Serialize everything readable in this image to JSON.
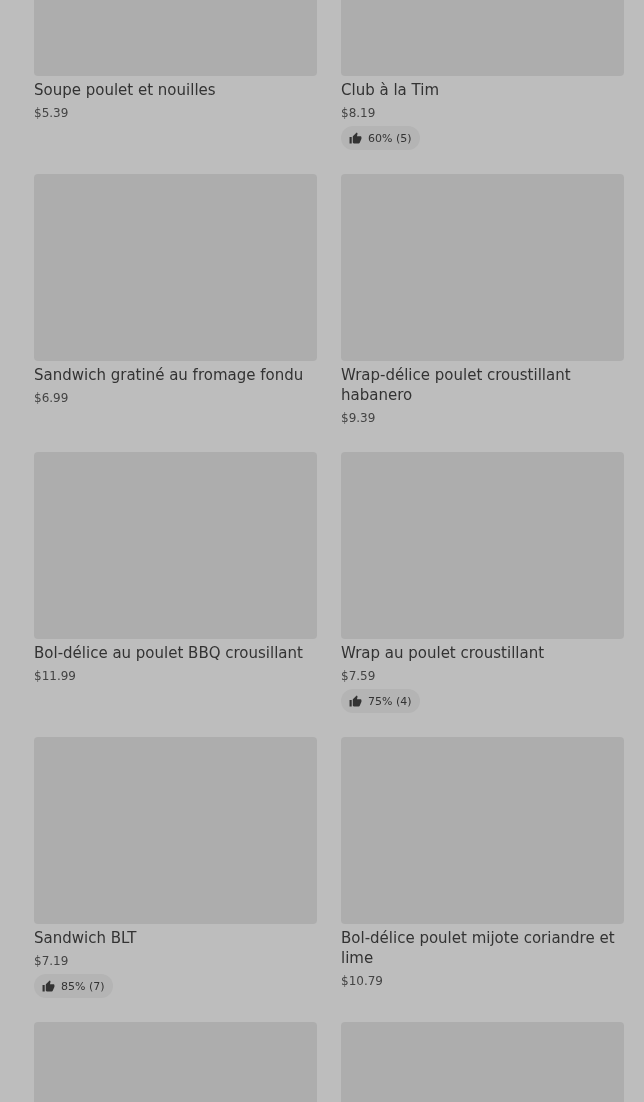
{
  "menu_items": [
    {
      "kind": "product",
      "name": "Soupe poulet et nouilles",
      "price": "$5.39"
    },
    {
      "kind": "product",
      "name": "Club à la Tim",
      "price": "$8.19",
      "rating": "60% (5)"
    },
    {
      "kind": "product",
      "name": "Sandwich gratiné au fromage fondu",
      "price": "$6.99"
    },
    {
      "kind": "product",
      "name": "Wrap-délice poulet croustillant habanero",
      "price": "$9.39"
    },
    {
      "kind": "product",
      "name": "Bol-délice au poulet BBQ crousillant",
      "price": "$11.99"
    },
    {
      "kind": "product",
      "name": "Wrap au poulet croustillant",
      "price": "$7.59",
      "rating": "75% (4)"
    },
    {
      "kind": "product",
      "name": "Sandwich BLT",
      "price": "$7.19",
      "rating": "85% (7)"
    },
    {
      "kind": "product",
      "name": "Bol-délice poulet mijote coriandre et lime",
      "price": "$10.79"
    },
    {
      "kind": "image-only"
    },
    {
      "kind": "image-only"
    }
  ]
}
